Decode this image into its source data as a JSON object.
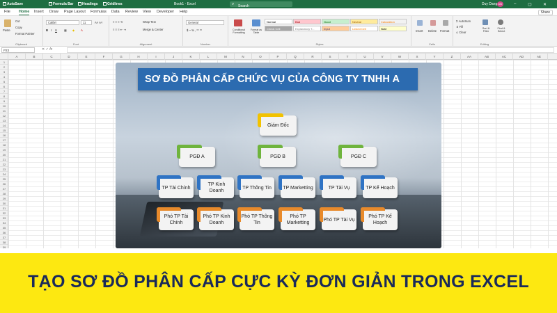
{
  "titlebar": {
    "autosave": "AutoSave",
    "formula_bar": "Formula Bar",
    "headings": "Headings",
    "gridlines": "Gridlines",
    "filename": "Book1 - Excel",
    "search": "Search",
    "user": "Duy Dang",
    "avatar": "DD",
    "share": "Share"
  },
  "tabs": [
    "File",
    "Home",
    "Insert",
    "Draw",
    "Page Layout",
    "Formulas",
    "Data",
    "Review",
    "View",
    "Developer",
    "Help"
  ],
  "active_tab": "Home",
  "ribbon": {
    "clipboard": {
      "paste": "Paste",
      "cut": "Cut",
      "copy": "Copy",
      "format_painter": "Format Painter",
      "label": "Clipboard"
    },
    "font": {
      "name": "Calibri",
      "size": "11",
      "label": "Font"
    },
    "alignment": {
      "wrap": "Wrap Text",
      "merge": "Merge & Center",
      "label": "Alignment"
    },
    "number": {
      "format": "General",
      "label": "Number"
    },
    "styles": {
      "conditional": "Conditional Formatting",
      "format_table": "Format as Table",
      "cells": [
        {
          "text": "Normal",
          "bg": "#ffffff",
          "fg": "#000000"
        },
        {
          "text": "Bad",
          "bg": "#ffc7ce",
          "fg": "#9c0006"
        },
        {
          "text": "Good",
          "bg": "#c6efce",
          "fg": "#006100"
        },
        {
          "text": "Neutral",
          "bg": "#ffeb9c",
          "fg": "#9c5700"
        },
        {
          "text": "Calculation",
          "bg": "#f2f2f2",
          "fg": "#fa7d00"
        },
        {
          "text": "Check Cell",
          "bg": "#a5a5a5",
          "fg": "#ffffff"
        },
        {
          "text": "Explanatory T...",
          "bg": "#ffffff",
          "fg": "#7f7f7f"
        },
        {
          "text": "Input",
          "bg": "#ffcc99",
          "fg": "#3f3f76"
        },
        {
          "text": "Linked Cell",
          "bg": "#ffffff",
          "fg": "#fa7d00"
        },
        {
          "text": "Note",
          "bg": "#ffffcc",
          "fg": "#000000"
        }
      ],
      "label": "Styles"
    },
    "cells_group": {
      "insert": "Insert",
      "delete": "Delete",
      "format": "Format",
      "label": "Cells"
    },
    "editing": {
      "autosum": "AutoSum",
      "fill": "Fill",
      "clear": "Clear",
      "sort": "Sort & Filter",
      "find": "Find & Select",
      "label": "Editing"
    }
  },
  "formula": {
    "namebox": "P23",
    "fx": "fx"
  },
  "columns": [
    "A",
    "B",
    "C",
    "D",
    "E",
    "F",
    "G",
    "H",
    "I",
    "J",
    "K",
    "L",
    "M",
    "N",
    "O",
    "P",
    "Q",
    "R",
    "S",
    "T",
    "U",
    "V",
    "W",
    "X",
    "Y",
    "Z",
    "AA",
    "AB",
    "AC",
    "AD",
    "AE"
  ],
  "rows": [
    "1",
    "2",
    "3",
    "4",
    "5",
    "6",
    "7",
    "8",
    "9",
    "10",
    "11",
    "12",
    "13",
    "14",
    "15",
    "16",
    "17",
    "18",
    "19",
    "20",
    "21",
    "22",
    "23",
    "24",
    "25",
    "26",
    "27",
    "28",
    "29",
    "30",
    "31",
    "32",
    "33",
    "34",
    "35",
    "36",
    "37",
    "38",
    "39"
  ],
  "chart": {
    "title": "SƠ ĐỒ PHÂN CẤP CHỨC VỤ CỦA CÔNG TY TNHH A",
    "director": "Giám Đốc",
    "deputies": [
      "PGĐ A",
      "PGĐ B",
      "PGĐ C"
    ],
    "heads": [
      "TP Tài Chính",
      "TP  Kinh Doanh",
      "TP Thông Tin",
      "TP Marketting",
      "TP Tài Vụ",
      "TP Kế Hoạch"
    ],
    "vice_heads": [
      "Phó TP Tài Chính",
      "Phó TP Kinh Doanh",
      "Phó TP Thông Tin",
      "Phó TP Marketting",
      "Phó TP Tài Vụ",
      "Phó TP Kế Hoạch"
    ]
  },
  "headline": "TẠO SƠ ĐỒ PHÂN CẤP CỰC KỲ ĐƠN GIẢN TRONG EXCEL"
}
